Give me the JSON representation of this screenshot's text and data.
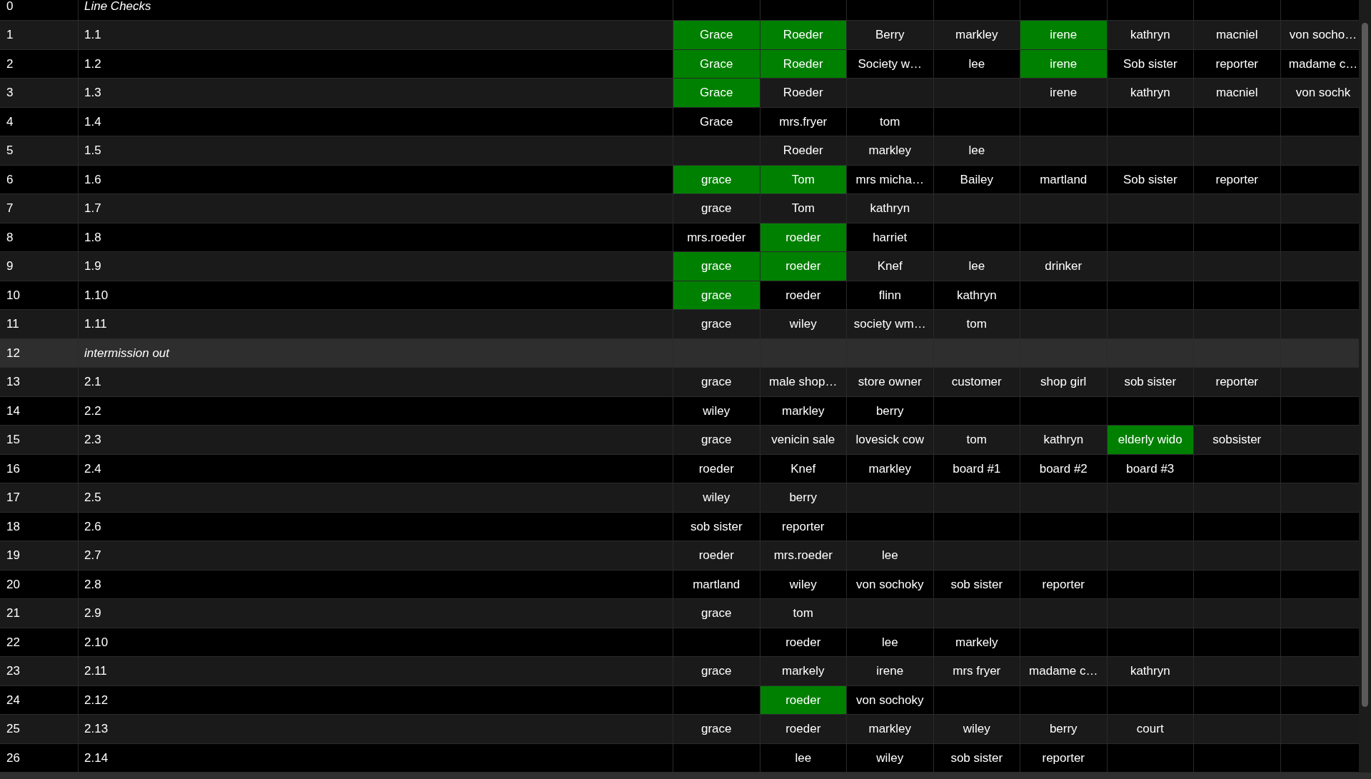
{
  "rows": [
    {
      "number": "0",
      "label": "Line Checks",
      "kind": "section",
      "selected": false,
      "cells": [
        null,
        null,
        null,
        null,
        null,
        null,
        null,
        null
      ]
    },
    {
      "number": "1",
      "label": "1.1",
      "kind": "cue",
      "selected": false,
      "cells": [
        {
          "text": "Grace",
          "highlighted": true
        },
        {
          "text": "Roeder",
          "highlighted": true
        },
        {
          "text": "Berry",
          "highlighted": false
        },
        {
          "text": "markley",
          "highlighted": false
        },
        {
          "text": "irene",
          "highlighted": true
        },
        {
          "text": "kathryn",
          "highlighted": false
        },
        {
          "text": "macniel",
          "highlighted": false
        },
        {
          "text": "von socho…",
          "highlighted": false
        }
      ]
    },
    {
      "number": "2",
      "label": "1.2",
      "kind": "cue",
      "selected": false,
      "cells": [
        {
          "text": "Grace",
          "highlighted": true
        },
        {
          "text": "Roeder",
          "highlighted": true
        },
        {
          "text": "Society w…",
          "highlighted": false
        },
        {
          "text": "lee",
          "highlighted": false
        },
        {
          "text": "irene",
          "highlighted": true
        },
        {
          "text": "Sob sister",
          "highlighted": false
        },
        {
          "text": "reporter",
          "highlighted": false
        },
        {
          "text": "madame c…",
          "highlighted": false
        }
      ]
    },
    {
      "number": "3",
      "label": "1.3",
      "kind": "cue",
      "selected": false,
      "cells": [
        {
          "text": "Grace",
          "highlighted": true
        },
        {
          "text": "Roeder",
          "highlighted": false
        },
        null,
        null,
        {
          "text": "irene",
          "highlighted": false
        },
        {
          "text": "kathryn",
          "highlighted": false
        },
        {
          "text": "macniel",
          "highlighted": false
        },
        {
          "text": "von sochk",
          "highlighted": false
        }
      ]
    },
    {
      "number": "4",
      "label": "1.4",
      "kind": "cue",
      "selected": false,
      "cells": [
        {
          "text": "Grace",
          "highlighted": false
        },
        {
          "text": "mrs.fryer",
          "highlighted": false
        },
        {
          "text": "tom",
          "highlighted": false
        },
        null,
        null,
        null,
        null,
        null
      ]
    },
    {
      "number": "5",
      "label": "1.5",
      "kind": "cue",
      "selected": false,
      "cells": [
        null,
        {
          "text": "Roeder",
          "highlighted": false
        },
        {
          "text": "markley",
          "highlighted": false
        },
        {
          "text": "lee",
          "highlighted": false
        },
        null,
        null,
        null,
        null
      ]
    },
    {
      "number": "6",
      "label": "1.6",
      "kind": "cue",
      "selected": false,
      "cells": [
        {
          "text": "grace",
          "highlighted": true
        },
        {
          "text": "Tom",
          "highlighted": true
        },
        {
          "text": "mrs micha…",
          "highlighted": false
        },
        {
          "text": "Bailey",
          "highlighted": false
        },
        {
          "text": "martland",
          "highlighted": false
        },
        {
          "text": "Sob sister",
          "highlighted": false
        },
        {
          "text": "reporter",
          "highlighted": false
        },
        null
      ]
    },
    {
      "number": "7",
      "label": "1.7",
      "kind": "cue",
      "selected": false,
      "cells": [
        {
          "text": "grace",
          "highlighted": false
        },
        {
          "text": "Tom",
          "highlighted": false
        },
        {
          "text": "kathryn",
          "highlighted": false
        },
        null,
        null,
        null,
        null,
        null
      ]
    },
    {
      "number": "8",
      "label": "1.8",
      "kind": "cue",
      "selected": false,
      "cells": [
        {
          "text": "mrs.roeder",
          "highlighted": false
        },
        {
          "text": "roeder",
          "highlighted": true
        },
        {
          "text": "harriet",
          "highlighted": false
        },
        null,
        null,
        null,
        null,
        null
      ]
    },
    {
      "number": "9",
      "label": "1.9",
      "kind": "cue",
      "selected": false,
      "cells": [
        {
          "text": "grace",
          "highlighted": true
        },
        {
          "text": "roeder",
          "highlighted": true
        },
        {
          "text": "Knef",
          "highlighted": false
        },
        {
          "text": "lee",
          "highlighted": false
        },
        {
          "text": "drinker",
          "highlighted": false
        },
        null,
        null,
        null
      ]
    },
    {
      "number": "10",
      "label": "1.10",
      "kind": "cue",
      "selected": false,
      "cells": [
        {
          "text": "grace",
          "highlighted": true
        },
        {
          "text": "roeder",
          "highlighted": false
        },
        {
          "text": "flinn",
          "highlighted": false
        },
        {
          "text": "kathryn",
          "highlighted": false
        },
        null,
        null,
        null,
        null
      ]
    },
    {
      "number": "11",
      "label": "1.11",
      "kind": "cue",
      "selected": false,
      "cells": [
        {
          "text": "grace",
          "highlighted": false
        },
        {
          "text": "wiley",
          "highlighted": false
        },
        {
          "text": "society wm…",
          "highlighted": false
        },
        {
          "text": "tom",
          "highlighted": false
        },
        null,
        null,
        null,
        null
      ]
    },
    {
      "number": "12",
      "label": "intermission out",
      "kind": "section",
      "selected": true,
      "cells": [
        null,
        null,
        null,
        null,
        null,
        null,
        null,
        null
      ]
    },
    {
      "number": "13",
      "label": "2.1",
      "kind": "cue",
      "selected": false,
      "cells": [
        {
          "text": "grace",
          "highlighted": false
        },
        {
          "text": "male shop…",
          "highlighted": false
        },
        {
          "text": "store owner",
          "highlighted": false
        },
        {
          "text": "customer",
          "highlighted": false
        },
        {
          "text": "shop girl",
          "highlighted": false
        },
        {
          "text": "sob sister",
          "highlighted": false
        },
        {
          "text": "reporter",
          "highlighted": false
        },
        null
      ]
    },
    {
      "number": "14",
      "label": "2.2",
      "kind": "cue",
      "selected": false,
      "cells": [
        {
          "text": "wiley",
          "highlighted": false
        },
        {
          "text": "markley",
          "highlighted": false
        },
        {
          "text": "berry",
          "highlighted": false
        },
        null,
        null,
        null,
        null,
        null
      ]
    },
    {
      "number": "15",
      "label": "2.3",
      "kind": "cue",
      "selected": false,
      "cells": [
        {
          "text": "grace",
          "highlighted": false
        },
        {
          "text": "venicin sale",
          "highlighted": false
        },
        {
          "text": "lovesick cow",
          "highlighted": false
        },
        {
          "text": "tom",
          "highlighted": false
        },
        {
          "text": "kathryn",
          "highlighted": false
        },
        {
          "text": "elderly wido",
          "highlighted": true
        },
        {
          "text": "sobsister",
          "highlighted": false
        },
        null
      ]
    },
    {
      "number": "16",
      "label": "2.4",
      "kind": "cue",
      "selected": false,
      "cells": [
        {
          "text": "roeder",
          "highlighted": false
        },
        {
          "text": "Knef",
          "highlighted": false
        },
        {
          "text": "markley",
          "highlighted": false
        },
        {
          "text": "board #1",
          "highlighted": false
        },
        {
          "text": "board #2",
          "highlighted": false
        },
        {
          "text": "board #3",
          "highlighted": false
        },
        null,
        null
      ]
    },
    {
      "number": "17",
      "label": "2.5",
      "kind": "cue",
      "selected": false,
      "cells": [
        {
          "text": "wiley",
          "highlighted": false
        },
        {
          "text": "berry",
          "highlighted": false
        },
        null,
        null,
        null,
        null,
        null,
        null
      ]
    },
    {
      "number": "18",
      "label": "2.6",
      "kind": "cue",
      "selected": false,
      "cells": [
        {
          "text": "sob sister",
          "highlighted": false
        },
        {
          "text": "reporter",
          "highlighted": false
        },
        null,
        null,
        null,
        null,
        null,
        null
      ]
    },
    {
      "number": "19",
      "label": "2.7",
      "kind": "cue",
      "selected": false,
      "cells": [
        {
          "text": "roeder",
          "highlighted": false
        },
        {
          "text": "mrs.roeder",
          "highlighted": false
        },
        {
          "text": "lee",
          "highlighted": false
        },
        null,
        null,
        null,
        null,
        null
      ]
    },
    {
      "number": "20",
      "label": "2.8",
      "kind": "cue",
      "selected": false,
      "cells": [
        {
          "text": "martland",
          "highlighted": false
        },
        {
          "text": "wiley",
          "highlighted": false
        },
        {
          "text": "von sochoky",
          "highlighted": false
        },
        {
          "text": "sob sister",
          "highlighted": false
        },
        {
          "text": "reporter",
          "highlighted": false
        },
        null,
        null,
        null
      ]
    },
    {
      "number": "21",
      "label": "2.9",
      "kind": "cue",
      "selected": false,
      "cells": [
        {
          "text": "grace",
          "highlighted": false
        },
        {
          "text": "tom",
          "highlighted": false
        },
        null,
        null,
        null,
        null,
        null,
        null
      ]
    },
    {
      "number": "22",
      "label": "2.10",
      "kind": "cue",
      "selected": false,
      "cells": [
        null,
        {
          "text": "roeder",
          "highlighted": false
        },
        {
          "text": "lee",
          "highlighted": false
        },
        {
          "text": "markely",
          "highlighted": false
        },
        null,
        null,
        null,
        null
      ]
    },
    {
      "number": "23",
      "label": "2.11",
      "kind": "cue",
      "selected": false,
      "cells": [
        {
          "text": "grace",
          "highlighted": false
        },
        {
          "text": "markely",
          "highlighted": false
        },
        {
          "text": "irene",
          "highlighted": false
        },
        {
          "text": "mrs fryer",
          "highlighted": false
        },
        {
          "text": "madame c…",
          "highlighted": false
        },
        {
          "text": "kathryn",
          "highlighted": false
        },
        null,
        null
      ]
    },
    {
      "number": "24",
      "label": "2.12",
      "kind": "cue",
      "selected": false,
      "cells": [
        null,
        {
          "text": "roeder",
          "highlighted": true
        },
        {
          "text": "von sochoky",
          "highlighted": false
        },
        null,
        null,
        null,
        null,
        null
      ]
    },
    {
      "number": "25",
      "label": "2.13",
      "kind": "cue",
      "selected": false,
      "cells": [
        {
          "text": "grace",
          "highlighted": false
        },
        {
          "text": "roeder",
          "highlighted": false
        },
        {
          "text": "markley",
          "highlighted": false
        },
        {
          "text": "wiley",
          "highlighted": false
        },
        {
          "text": "berry",
          "highlighted": false
        },
        {
          "text": "court",
          "highlighted": false
        },
        null,
        null
      ]
    },
    {
      "number": "26",
      "label": "2.14",
      "kind": "cue",
      "selected": false,
      "cells": [
        null,
        {
          "text": "lee",
          "highlighted": false
        },
        {
          "text": "wiley",
          "highlighted": false
        },
        {
          "text": "sob sister",
          "highlighted": false
        },
        {
          "text": "reporter",
          "highlighted": false
        },
        null,
        null,
        null
      ]
    }
  ]
}
